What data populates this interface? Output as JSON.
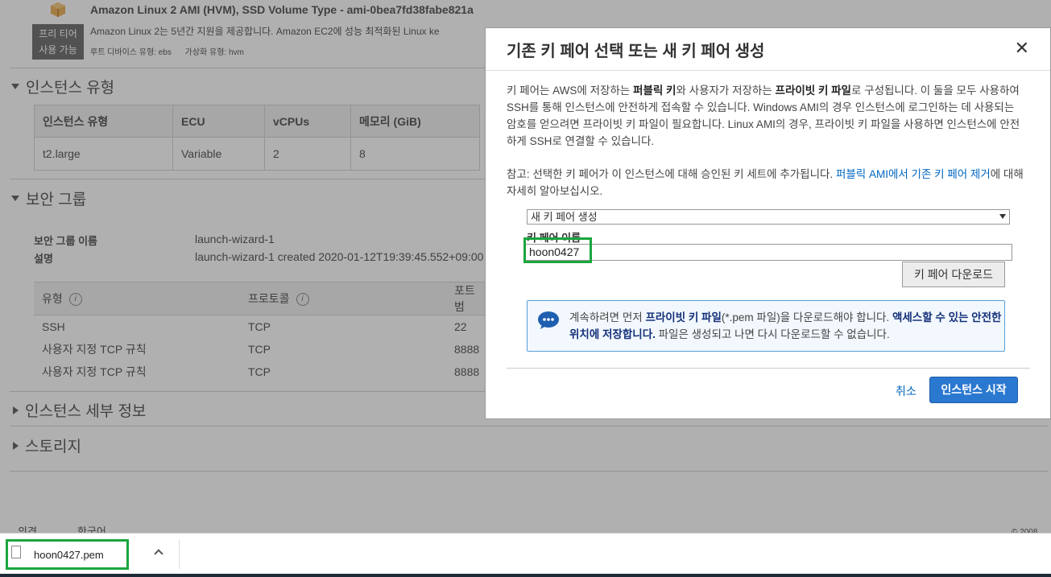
{
  "ami": {
    "icon": "package-box-icon",
    "title": "Amazon Linux 2 AMI (HVM), SSD Volume Type - ami-0bea7fd38fabe821a",
    "free_tier_line1": "프리 티어",
    "free_tier_line2": "사용 가능",
    "description": "Amazon Linux 2는 5년간 지원을 제공합니다. Amazon EC2에 성능 최적화된 Linux ke",
    "root_device": "루트 디바이스 유형: ebs",
    "virtualization": "가상화 유형: hvm"
  },
  "instance_type": {
    "heading": "인스턴스 유형",
    "headers": [
      "인스턴스 유형",
      "ECU",
      "vCPUs",
      "메모리 (GiB)"
    ],
    "row": [
      "t2.large",
      "Variable",
      "2",
      "8"
    ]
  },
  "security_group": {
    "heading": "보안 그룹",
    "name_label": "보안 그룹 이름",
    "name_value": "launch-wizard-1",
    "desc_label": "설명",
    "desc_value": "launch-wizard-1 created 2020-01-12T19:39:45.552+09:00",
    "rule_headers": [
      "유형",
      "프로토콜",
      "포트 범"
    ],
    "rules": [
      [
        "SSH",
        "TCP",
        "22"
      ],
      [
        "사용자 지정 TCP 규칙",
        "TCP",
        "8888"
      ],
      [
        "사용자 지정 TCP 규칙",
        "TCP",
        "8888"
      ]
    ]
  },
  "sections": {
    "instance_details": "인스턴스 세부 정보",
    "storage": "스토리지"
  },
  "footer": {
    "left1": "의견",
    "left2": "한국어",
    "right": "© 2008"
  },
  "modal": {
    "title": "기존 키 페어 선택 또는 새 키 페어 생성",
    "intro_1": "키 페어는 AWS에 저장하는 ",
    "intro_b1": "퍼블릭 키",
    "intro_2": "와 사용자가 저장하는 ",
    "intro_b2": "프라이빗 키 파일",
    "intro_3": "로 구성됩니다. 이 둘을 모두 사용하여 SSH를 통해 인스턴스에 안전하게 접속할 수 있습니다. Windows AMI의 경우 인스턴스에 로그인하는 데 사용되는 암호를 얻으려면 프라이빗 키 파일이 필요합니다. Linux AMI의 경우, 프라이빗 키 파일을 사용하면 인스턴스에 안전하게 SSH로 연결할 수 있습니다.",
    "note_1": "참고: 선택한 키 페어가 이 인스턴스에 대해 승인된 키 세트에 추가됩니다. ",
    "note_link": "퍼블릭 AMI에서 기존 키 페어 제거",
    "note_2": "에 대해 자세히 알아보십시오.",
    "select_value": "새 키 페어 생성",
    "key_name_label": "키 페어 이름",
    "key_name_value": "hoon0427",
    "download_button": "키 페어 다운로드",
    "alert_1": "계속하려면 먼저 ",
    "alert_b1": "프라이빗 키 파일",
    "alert_2": "(*.pem 파일)을 다운로드해야 합니다. ",
    "alert_b2": "액세스할 수 있는 안전한 위치에 저장합니다.",
    "alert_3": " 파일은 생성되고 나면 다시 다운로드할 수 없습니다.",
    "cancel": "취소",
    "launch": "인스턴스 시작"
  },
  "download_bar": {
    "filename": "hoon0427.pem"
  },
  "colors": {
    "highlight": "#1aa63d",
    "primary_button": "#2a78d0",
    "link": "#0066c0"
  }
}
